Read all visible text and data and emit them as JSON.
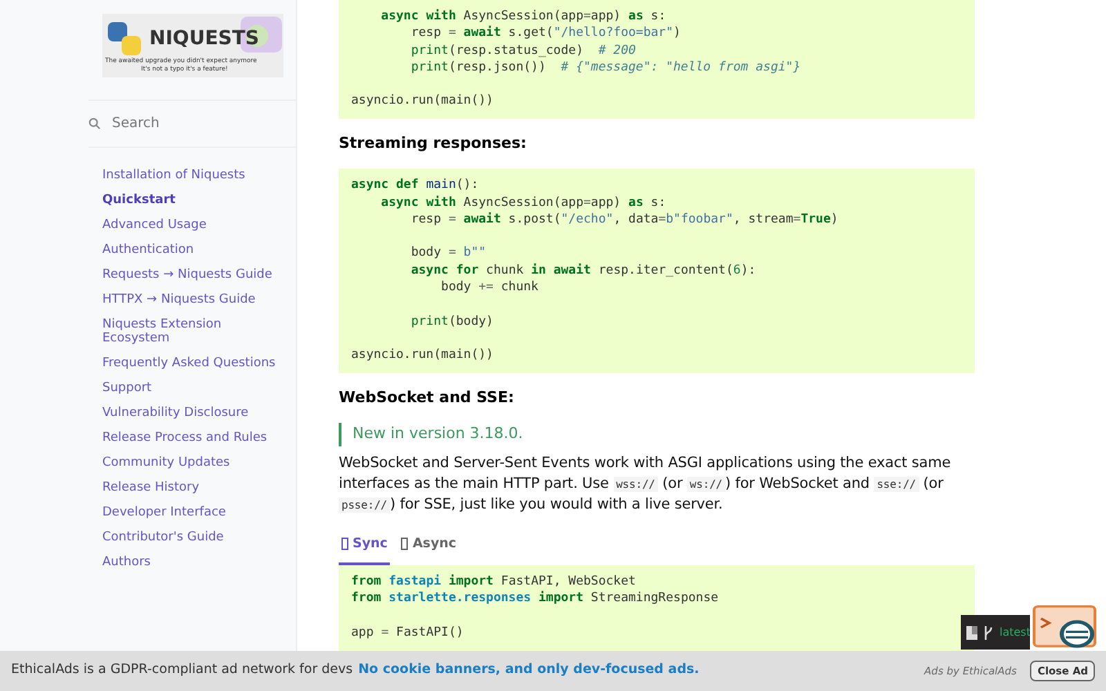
{
  "sidebar": {
    "logo": {
      "title": "NIQUESTS",
      "tagline_1": "The awaited upgrade you didn't expect anymore",
      "tagline_2": "It's not a typo it's a feature!"
    },
    "search": {
      "placeholder": "Search"
    },
    "items": [
      {
        "label": "Installation of Niquests",
        "selected": false
      },
      {
        "label": "Quickstart",
        "selected": true
      },
      {
        "label": "Advanced Usage",
        "selected": false
      },
      {
        "label": "Authentication",
        "selected": false
      },
      {
        "label": "Requests → Niquests Guide",
        "selected": false
      },
      {
        "label": "HTTPX → Niquests Guide",
        "selected": false
      },
      {
        "label": "Niquests Extension Ecosystem",
        "selected": false
      },
      {
        "label": "Frequently Asked Questions",
        "selected": false
      },
      {
        "label": "Support",
        "selected": false
      },
      {
        "label": "Vulnerability Disclosure",
        "selected": false
      },
      {
        "label": "Release Process and Rules",
        "selected": false
      },
      {
        "label": "Community Updates",
        "selected": false
      },
      {
        "label": "Release History",
        "selected": false
      },
      {
        "label": "Developer Interface",
        "selected": false
      },
      {
        "label": "Contributor's Guide",
        "selected": false
      },
      {
        "label": "Authors",
        "selected": false
      }
    ]
  },
  "content": [
    {
      "kind": "code",
      "lines": [
        {
          "tokens": [
            {
              "text": "    async",
              "kind": "keyword"
            },
            {
              "text": " with",
              "kind": "keyword"
            },
            {
              "text": " AsyncSession(app",
              "kind": "plain"
            },
            {
              "text": "=",
              "kind": "operator"
            },
            {
              "text": "app)",
              "kind": "plain"
            },
            {
              "text": " as",
              "kind": "keyword"
            },
            {
              "text": " s:",
              "kind": "plain"
            }
          ]
        },
        {
          "tokens": [
            {
              "text": "        resp ",
              "kind": "plain"
            },
            {
              "text": "=",
              "kind": "operator"
            },
            {
              "text": " await",
              "kind": "keyword"
            },
            {
              "text": " s.get(",
              "kind": "plain"
            },
            {
              "text": "\"/hello?foo=bar\"",
              "kind": "string"
            },
            {
              "text": ")",
              "kind": "plain"
            }
          ]
        },
        {
          "tokens": [
            {
              "text": "        print",
              "kind": "builtin"
            },
            {
              "text": "(resp.status_code)  ",
              "kind": "plain"
            },
            {
              "text": "# 200",
              "kind": "comment"
            }
          ]
        },
        {
          "tokens": [
            {
              "text": "        print",
              "kind": "builtin"
            },
            {
              "text": "(resp.json())  ",
              "kind": "plain"
            },
            {
              "text": "# {\"message\": \"hello from asgi\"}",
              "kind": "comment"
            }
          ]
        },
        {
          "blank": true
        },
        {
          "tokens": [
            {
              "text": "asyncio.run(main())",
              "kind": "plain"
            }
          ]
        }
      ]
    },
    {
      "kind": "heading",
      "text": "Streaming responses:"
    },
    {
      "kind": "code",
      "lines": [
        {
          "tokens": [
            {
              "text": "async",
              "kind": "keyword"
            },
            {
              "text": " def",
              "kind": "keyword"
            },
            {
              "text": " main",
              "kind": "function"
            },
            {
              "text": "():",
              "kind": "plain"
            }
          ]
        },
        {
          "tokens": [
            {
              "text": "    async",
              "kind": "keyword"
            },
            {
              "text": " with",
              "kind": "keyword"
            },
            {
              "text": " AsyncSession(app",
              "kind": "plain"
            },
            {
              "text": "=",
              "kind": "operator"
            },
            {
              "text": "app)",
              "kind": "plain"
            },
            {
              "text": " as",
              "kind": "keyword"
            },
            {
              "text": " s:",
              "kind": "plain"
            }
          ]
        },
        {
          "tokens": [
            {
              "text": "        resp ",
              "kind": "plain"
            },
            {
              "text": "=",
              "kind": "operator"
            },
            {
              "text": " await",
              "kind": "keyword"
            },
            {
              "text": " s.post(",
              "kind": "plain"
            },
            {
              "text": "\"/echo\"",
              "kind": "string"
            },
            {
              "text": ", data",
              "kind": "plain"
            },
            {
              "text": "=",
              "kind": "operator"
            },
            {
              "text": "b\"foobar\"",
              "kind": "string"
            },
            {
              "text": ", stream",
              "kind": "plain"
            },
            {
              "text": "=",
              "kind": "operator"
            },
            {
              "text": "True",
              "kind": "keyword"
            },
            {
              "text": ")",
              "kind": "plain"
            }
          ]
        },
        {
          "blank": true
        },
        {
          "tokens": [
            {
              "text": "        body ",
              "kind": "plain"
            },
            {
              "text": "=",
              "kind": "operator"
            },
            {
              "text": " b\"\"",
              "kind": "string"
            }
          ]
        },
        {
          "tokens": [
            {
              "text": "        async",
              "kind": "keyword"
            },
            {
              "text": " for",
              "kind": "keyword"
            },
            {
              "text": " chunk ",
              "kind": "plain"
            },
            {
              "text": "in",
              "kind": "keyword"
            },
            {
              "text": " await",
              "kind": "keyword"
            },
            {
              "text": " resp.iter_content(",
              "kind": "plain"
            },
            {
              "text": "6",
              "kind": "number"
            },
            {
              "text": "):",
              "kind": "plain"
            }
          ]
        },
        {
          "tokens": [
            {
              "text": "            body ",
              "kind": "plain"
            },
            {
              "text": "+=",
              "kind": "operator"
            },
            {
              "text": " chunk",
              "kind": "plain"
            }
          ]
        },
        {
          "blank": true
        },
        {
          "tokens": [
            {
              "text": "        print",
              "kind": "builtin"
            },
            {
              "text": "(body)",
              "kind": "plain"
            }
          ]
        },
        {
          "blank": true
        },
        {
          "tokens": [
            {
              "text": "asyncio.run(main())",
              "kind": "plain"
            }
          ]
        }
      ]
    },
    {
      "kind": "heading",
      "text": "WebSocket and SSE:"
    },
    {
      "kind": "note",
      "text": "New in version 3.18.0."
    },
    {
      "kind": "paragraph",
      "parts": [
        {
          "kind": "text",
          "text": "WebSocket and Server-Sent Events work with ASGI applications using the exact same interfaces as the main HTTP part. Use "
        },
        {
          "kind": "code",
          "text": "wss://"
        },
        {
          "kind": "text",
          "text": " (or "
        },
        {
          "kind": "code",
          "text": "ws://"
        },
        {
          "kind": "text",
          "text": ") for WebSocket and "
        },
        {
          "kind": "code",
          "text": "sse://"
        },
        {
          "kind": "text",
          "text": " (or "
        },
        {
          "kind": "code",
          "text": "psse://"
        },
        {
          "kind": "text",
          "text": ") for SSE, just like you would with a live server."
        }
      ]
    },
    {
      "kind": "tabs",
      "tabs": [
        {
          "label": "Sync",
          "selected": true
        },
        {
          "label": "Async",
          "selected": false
        }
      ]
    },
    {
      "kind": "code",
      "lines": [
        {
          "tokens": [
            {
              "text": "from",
              "kind": "keyword"
            },
            {
              "text": " fastapi",
              "kind": "namespace"
            },
            {
              "text": " import",
              "kind": "keyword"
            },
            {
              "text": " FastAPI, WebSocket",
              "kind": "plain"
            }
          ]
        },
        {
          "tokens": [
            {
              "text": "from",
              "kind": "keyword"
            },
            {
              "text": " starlette.responses",
              "kind": "namespace"
            },
            {
              "text": " import",
              "kind": "keyword"
            },
            {
              "text": " StreamingResponse",
              "kind": "plain"
            }
          ]
        },
        {
          "blank": true
        },
        {
          "tokens": [
            {
              "text": "app ",
              "kind": "plain"
            },
            {
              "text": "=",
              "kind": "operator"
            },
            {
              "text": " FastAPI()",
              "kind": "plain"
            }
          ]
        },
        {
          "blank": true
        }
      ]
    }
  ],
  "flyout": {
    "version": "latest"
  },
  "ad_bar": {
    "text": "EthicalAds is a GDPR-compliant ad network for devs",
    "link": "No cookie banners, and only dev-focused ads.",
    "credit": "Ads by EthicalAds",
    "close": "Close Ad"
  }
}
